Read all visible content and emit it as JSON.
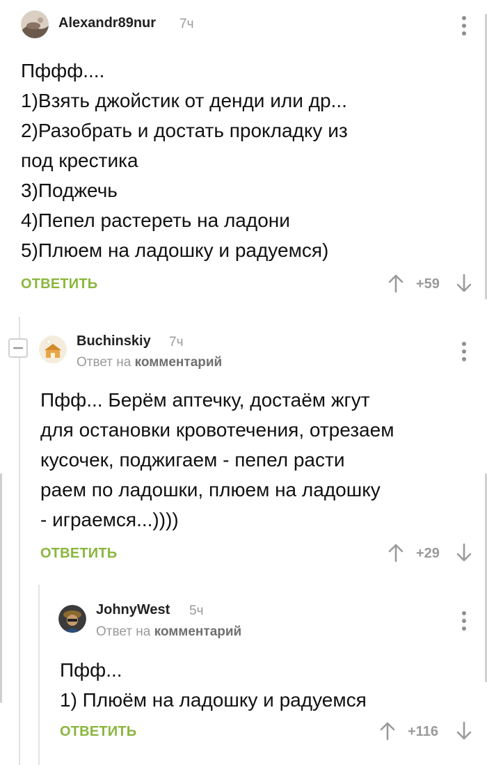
{
  "comments": [
    {
      "author": "Alexandr89nur",
      "time": "7ч",
      "body": "Пффф....\n1)Взять джойстик от денди или др...\n2)Разобрать и достать прокладку из\nпод крестика\n3)Поджечь\n4)Пепел растереть на ладони\n5)Плюем на ладошку и радуемся)",
      "reply_label": "ОТВЕТИТЬ",
      "rating": "+59"
    },
    {
      "author": "Buchinskiy",
      "time": "7ч",
      "reply_prefix": "Ответ на",
      "reply_target": "комментарий",
      "body": "Пфф... Берём аптечку, достаём жгут\nдля остановки кровотечения, отрезаем\nкусочек, поджигаем - пепел расти\nраем по ладошки, плюем на ладошку\n- играемся...))))",
      "reply_label": "ОТВЕТИТЬ",
      "rating": "+29"
    },
    {
      "author": "JohnyWest",
      "time": "5ч",
      "reply_prefix": "Ответ на",
      "reply_target": "комментарий",
      "body": "Пфф...\n1) Плюём на ладошку и радуемся",
      "reply_label": "ОТВЕТИТЬ",
      "rating": "+116"
    }
  ],
  "colors": {
    "accent": "#8ab63d",
    "muted": "#9a9a9a",
    "thread_line": "#e2e2e2"
  },
  "icons": [
    "avatar",
    "more-vertical-icon",
    "upvote-arrow-icon",
    "downvote-arrow-icon",
    "collapse-icon"
  ]
}
